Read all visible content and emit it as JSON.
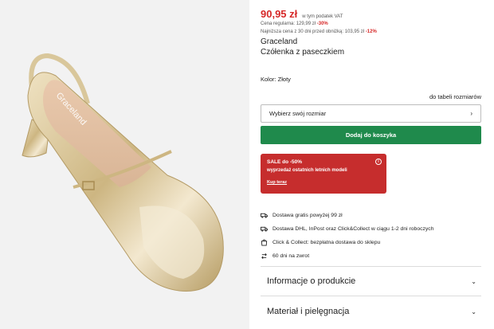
{
  "product": {
    "brand": "Graceland",
    "name": "Czółenka z paseczkiem",
    "price": "90,95 zł",
    "vat_note": "w tym podatek VAT",
    "regular_label": "Cena regularna:",
    "regular_price": "129,99 zł",
    "regular_discount": "-30%",
    "lowest_label": "Najniższa cena z 30 dni przed obniżką:",
    "lowest_price": "103,95 zł",
    "lowest_discount": "-12%",
    "color_label": "Kolor: Złoty",
    "image_brand_text": "Graceland"
  },
  "size": {
    "table_link": "do tabeli rozmiarów",
    "select_placeholder": "Wybierz swój rozmiar"
  },
  "cart": {
    "button_label": "Dodaj do koszyka"
  },
  "sale": {
    "title": "SALE do -50%",
    "subtitle": "wyprzedaż ostatnich letnich modeli",
    "link": "Kup teraz"
  },
  "features": [
    {
      "icon": "truck-icon",
      "text": "Dostawa gratis powyżej 99 zł"
    },
    {
      "icon": "truck-icon",
      "text": "Dostawa DHL, InPost oraz Click&Collect w ciągu 1-2 dni roboczych"
    },
    {
      "icon": "store-bag-icon",
      "text": "Click & Collect: bezpłatna dostawa do sklepu"
    },
    {
      "icon": "return-arrows-icon",
      "text": "60 dni na zwrot"
    }
  ],
  "accordions": [
    {
      "label": "Informacje o produkcie"
    },
    {
      "label": "Materiał i pielęgnacja"
    }
  ],
  "colors": {
    "price_red": "#d62828",
    "button_green": "#1f8a4c",
    "sale_red": "#c62d2d",
    "shoe_gold": "#d8c49a"
  }
}
